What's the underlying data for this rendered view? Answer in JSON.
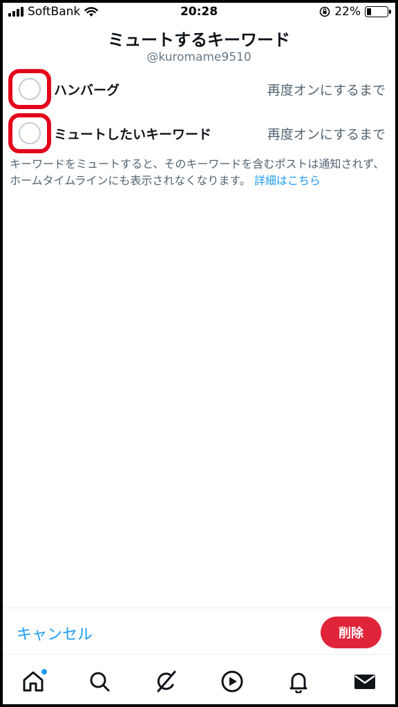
{
  "status_bar": {
    "carrier": "SoftBank",
    "time": "20:28",
    "battery": "22%",
    "battery_level": 0.22
  },
  "header": {
    "title": "ミュートするキーワード",
    "handle": "@kuromame9510"
  },
  "keywords": [
    {
      "label": "ハンバーグ",
      "duration": "再度オンにするまで",
      "selected": false
    },
    {
      "label": "ミュートしたいキーワード",
      "duration": "再度オンにするまで",
      "selected": false
    }
  ],
  "description": {
    "text": "キーワードをミュートすると、そのキーワードを含むポストは通知されず、ホームタイムラインにも表示されなくなります。",
    "link": "詳細はこちら"
  },
  "actions": {
    "cancel_label": "キャンセル",
    "delete_label": "削除"
  },
  "tabbar": {
    "items": [
      "home-icon",
      "search-icon",
      "grok-icon",
      "video-icon",
      "notifications-icon",
      "messages-icon"
    ],
    "home_has_badge": true
  },
  "colors": {
    "accent": "#1d9bf0",
    "delete": "#e0243a",
    "highlight": "#e3001b",
    "secondary_text": "#536471"
  }
}
